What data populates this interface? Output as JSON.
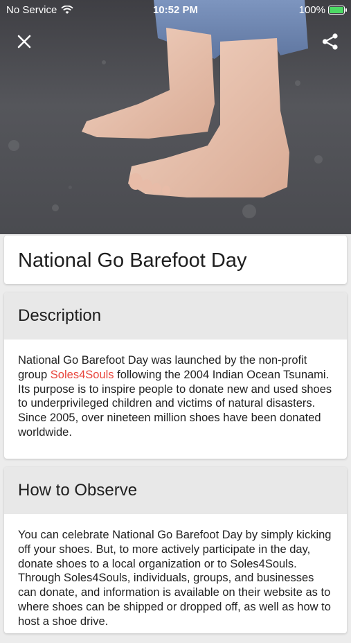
{
  "status_bar": {
    "carrier": "No Service",
    "time": "10:52 PM",
    "battery": "100%"
  },
  "icons": {
    "close": "close-icon",
    "share": "share-icon",
    "wifi": "wifi-icon",
    "battery": "battery-icon"
  },
  "title": "National Go Barefoot Day",
  "description": {
    "heading": "Description",
    "text_before_link": "National Go Barefoot Day was launched by the non-profit group ",
    "link_text": "Soles4Souls",
    "text_after_link": " following the 2004 Indian Ocean Tsunami. Its purpose is to inspire people to donate new and used shoes to underprivileged children and victims of natural disasters. Since 2005, over nineteen million shoes have been donated worldwide."
  },
  "how_to_observe": {
    "heading": "How to Observe",
    "text": "You can celebrate National Go Barefoot Day by simply kicking off your shoes. But, to more actively participate in the day, donate shoes to a local organization or to Soles4Souls. Through Soles4Souls, individuals, groups, and businesses can donate, and information is available on their website as to where shoes can be shipped or dropped off, as well as how to host a shoe drive."
  },
  "colors": {
    "link": "#e8453c",
    "section_header_bg": "#e8e8e8",
    "page_bg": "#ececec"
  }
}
